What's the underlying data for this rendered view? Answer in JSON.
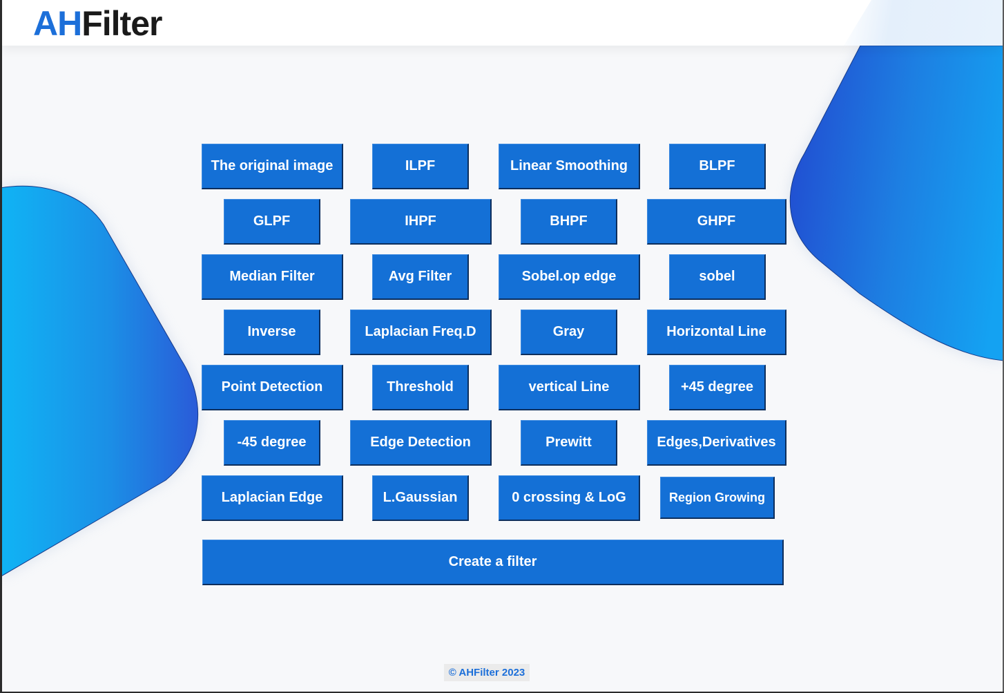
{
  "app": {
    "logo_part1": "AH",
    "logo_part2": "Filter",
    "accent_color": "#1470d6"
  },
  "filters": [
    "The original image",
    "ILPF",
    "Linear Smoothing",
    "BLPF",
    "GLPF",
    "IHPF",
    "BHPF",
    "GHPF",
    "Median Filter",
    "Avg Filter",
    "Sobel.op edge",
    "sobel",
    "Inverse",
    "Laplacian Freq.D",
    "Gray",
    "Horizontal Line",
    "Point Detection",
    "Threshold",
    "vertical Line",
    "+45 degree",
    "-45 degree",
    "Edge Detection",
    "Prewitt",
    "Edges,Derivatives",
    "Laplacian Edge",
    "L.Gaussian",
    "0 crossing & LoG",
    "Region Growing"
  ],
  "create_button": "Create a filter",
  "footer": "© AHFilter 2023"
}
